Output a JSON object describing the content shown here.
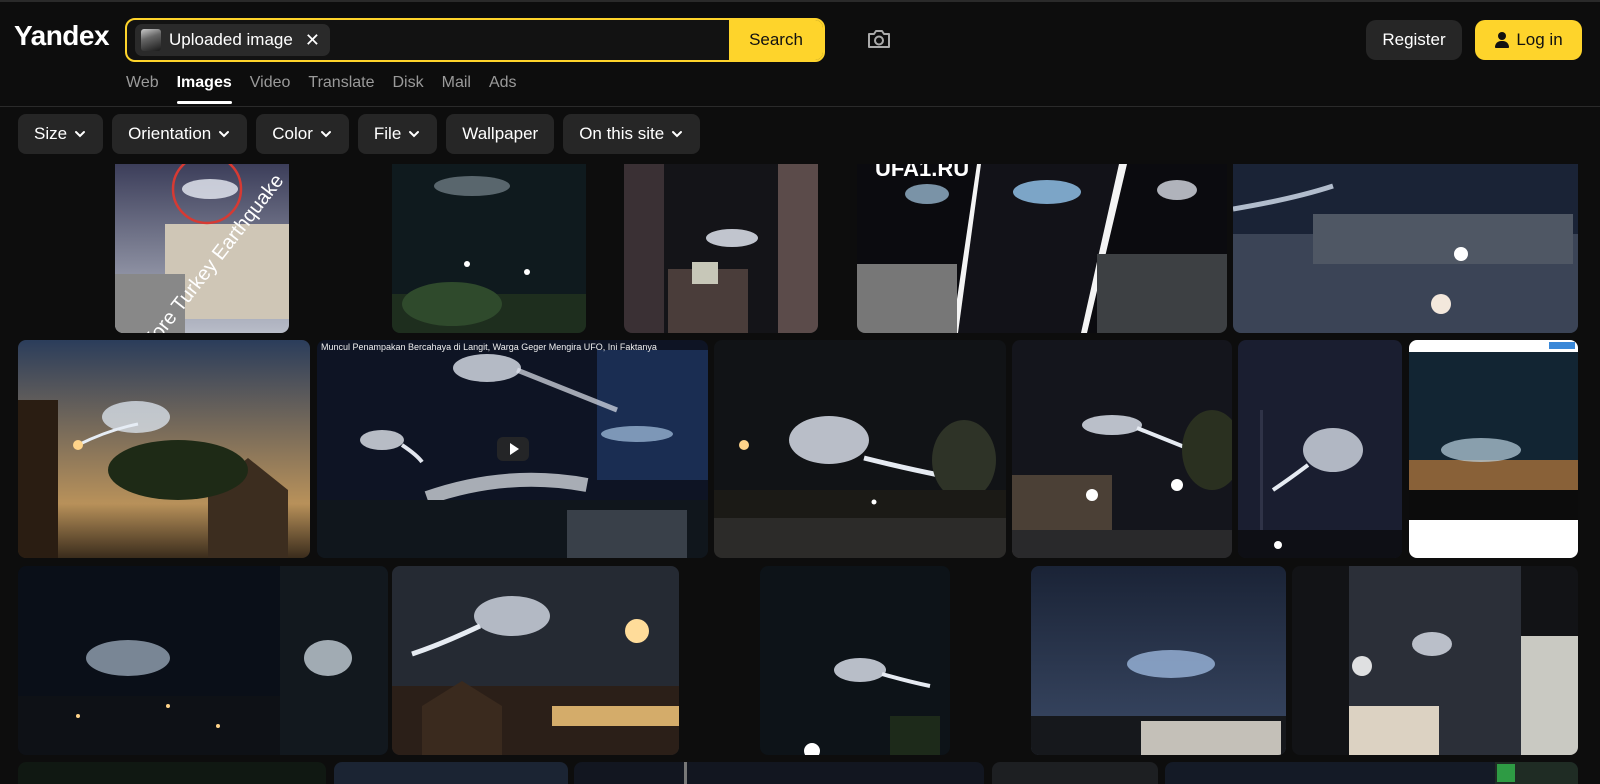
{
  "header": {
    "logo": "Yandex",
    "search": {
      "chip_label": "Uploaded image",
      "chip_close": "✕",
      "button": "Search"
    },
    "register": "Register",
    "login": "Log in"
  },
  "tabs": [
    {
      "label": "Web",
      "active": false
    },
    {
      "label": "Images",
      "active": true
    },
    {
      "label": "Video",
      "active": false
    },
    {
      "label": "Translate",
      "active": false
    },
    {
      "label": "Disk",
      "active": false
    },
    {
      "label": "Mail",
      "active": false
    },
    {
      "label": "Ads",
      "active": false
    }
  ],
  "filters": [
    {
      "label": "Size",
      "dropdown": true
    },
    {
      "label": "Orientation",
      "dropdown": true
    },
    {
      "label": "Color",
      "dropdown": true
    },
    {
      "label": "File",
      "dropdown": true
    },
    {
      "label": "Wallpaper",
      "dropdown": false
    },
    {
      "label": "On this site",
      "dropdown": true
    }
  ],
  "results": {
    "tile_texts": {
      "turkey": "fore Turkey Earthquake",
      "ufa": "UFA1.RU",
      "video_caption": "Muncul Penampakan Bercahaya di Langit, Warga Geger Mengira UFO, Ini Faktanya"
    }
  },
  "colors": {
    "accent": "#fed42b",
    "background": "#0d0d0d",
    "button_bg": "#262626"
  }
}
